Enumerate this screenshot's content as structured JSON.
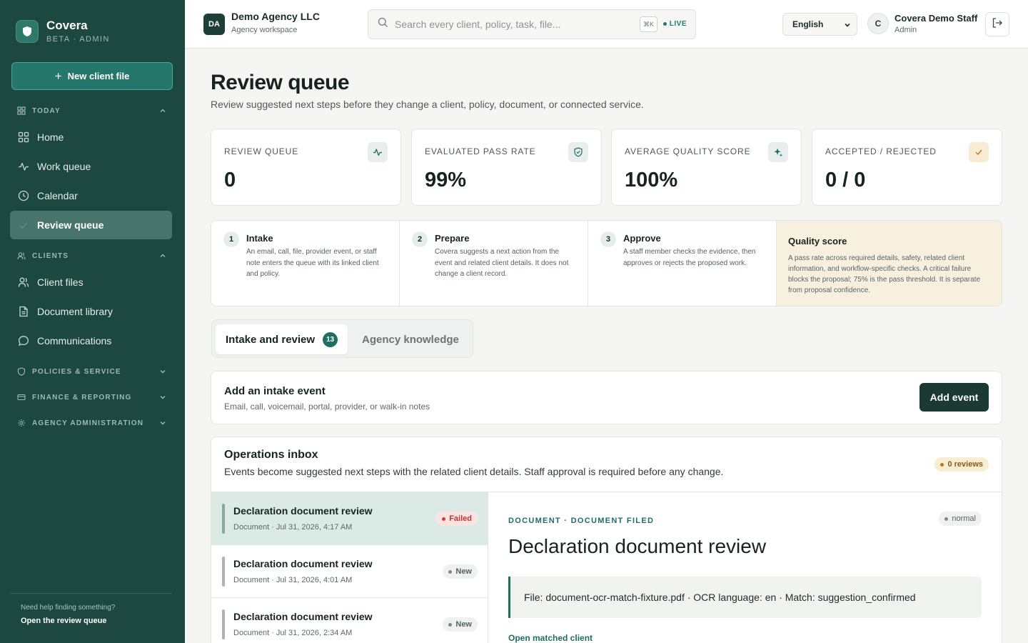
{
  "brand": {
    "name": "Covera",
    "sub": "BETA · ADMIN"
  },
  "sidebar": {
    "new_client": "New client file",
    "groups": {
      "today": "TODAY",
      "clients": "CLIENTS",
      "policies": "POLICIES & SERVICE",
      "finance": "FINANCE & REPORTING",
      "admin": "AGENCY ADMINISTRATION"
    },
    "items": {
      "home": "Home",
      "work_queue": "Work queue",
      "calendar": "Calendar",
      "review_queue": "Review queue",
      "client_files": "Client files",
      "document_library": "Document library",
      "communications": "Communications"
    },
    "footer": {
      "question": "Need help finding something?",
      "link": "Open the review queue"
    }
  },
  "topbar": {
    "agency_initials": "DA",
    "agency_name": "Demo Agency LLC",
    "agency_sub": "Agency workspace",
    "search_placeholder": "Search every client, policy, task, file...",
    "shortcut": "⌘K",
    "live": "LIVE",
    "language": "English",
    "user_initial": "C",
    "user_name": "Covera Demo Staff",
    "user_role": "Admin"
  },
  "page": {
    "title": "Review queue",
    "subtitle": "Review suggested next steps before they change a client, policy, document, or connected service."
  },
  "stats": [
    {
      "label": "REVIEW QUEUE",
      "value": "0",
      "icon": "activity-icon"
    },
    {
      "label": "EVALUATED PASS RATE",
      "value": "99%",
      "icon": "shield-check-icon"
    },
    {
      "label": "AVERAGE QUALITY SCORE",
      "value": "100%",
      "icon": "sparkle-icon"
    },
    {
      "label": "ACCEPTED / REJECTED",
      "value": "0 / 0",
      "icon": "check-icon"
    }
  ],
  "steps": [
    {
      "num": "1",
      "title": "Intake",
      "text": "An email, call, file, provider event, or staff note enters the queue with its linked client and policy."
    },
    {
      "num": "2",
      "title": "Prepare",
      "text": "Covera suggests a next action from the event and related client details. It does not change a client record."
    },
    {
      "num": "3",
      "title": "Approve",
      "text": "A staff member checks the evidence, then approves or rejects the proposed work."
    }
  ],
  "quality": {
    "title": "Quality score",
    "text": "A pass rate across required details, safety, related client information, and workflow-specific checks. A critical failure blocks the proposal; 75% is the pass threshold. It is separate from proposal confidence."
  },
  "tabs": {
    "intake": "Intake and review",
    "intake_count": "13",
    "knowledge": "Agency knowledge"
  },
  "intake": {
    "title": "Add an intake event",
    "subtitle": "Email, call, voicemail, portal, provider, or walk-in notes",
    "button": "Add event"
  },
  "inbox": {
    "title": "Operations inbox",
    "subtitle": "Events become suggested next steps with the related client details. Staff approval is required before any change.",
    "badge": "0 reviews",
    "rows": [
      {
        "title": "Declaration document review",
        "meta": "Document · Jul 31, 2026, 4:17 AM",
        "status": "Failed"
      },
      {
        "title": "Declaration document review",
        "meta": "Document · Jul 31, 2026, 4:01 AM",
        "status": "New"
      },
      {
        "title": "Declaration document review",
        "meta": "Document · Jul 31, 2026, 2:34 AM",
        "status": "New"
      }
    ]
  },
  "detail": {
    "kicker": "DOCUMENT · DOCUMENT FILED",
    "priority": "normal",
    "title": "Declaration document review",
    "info": "File: document-ocr-match-fixture.pdf · OCR language: en · Match: suggestion_confirmed",
    "link": "Open matched client"
  },
  "colors": {
    "sidebar": "#1d4840",
    "accent": "#1f6e60",
    "failed": "#c74139",
    "warning": "#b97a16"
  }
}
